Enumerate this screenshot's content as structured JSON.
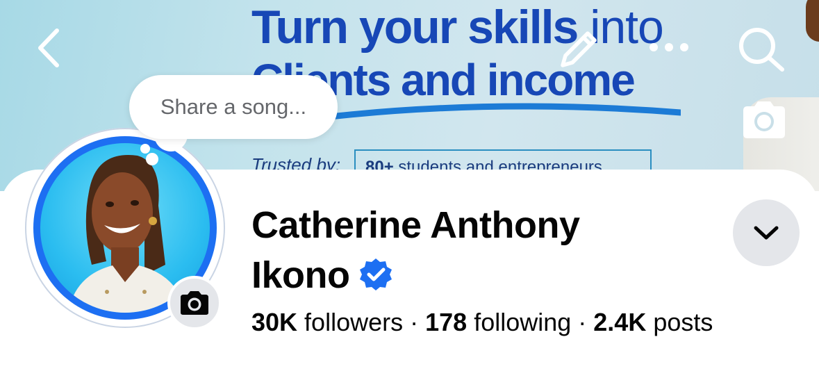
{
  "cover": {
    "headline_line1_bold": "Turn your skills",
    "headline_line1_light": " into",
    "headline_line2": "Clients and income",
    "trusted_label": "Trusted by:",
    "trusted_count": "80+",
    "trusted_text": " students and entrepreneurs",
    "headline_color": "#1747b6"
  },
  "nav": {
    "back_icon": "chevron-left-icon",
    "edit_icon": "pencil-icon",
    "more_icon": "more-dots-icon",
    "search_icon": "search-icon",
    "cover_camera_icon": "camera-icon"
  },
  "song_bubble": {
    "placeholder": "Share a song..."
  },
  "profile": {
    "name_line1": "Catherine Anthony",
    "name_line2": "Ikono",
    "verified": true,
    "verified_color": "#1d6ff2",
    "avatar_ring_color": "#1d6ff2"
  },
  "stats": {
    "followers_count": "30K",
    "followers_label": " followers",
    "following_count": "178",
    "following_label": " following",
    "posts_count": "2.4K",
    "posts_label": " posts",
    "separator": "·"
  }
}
